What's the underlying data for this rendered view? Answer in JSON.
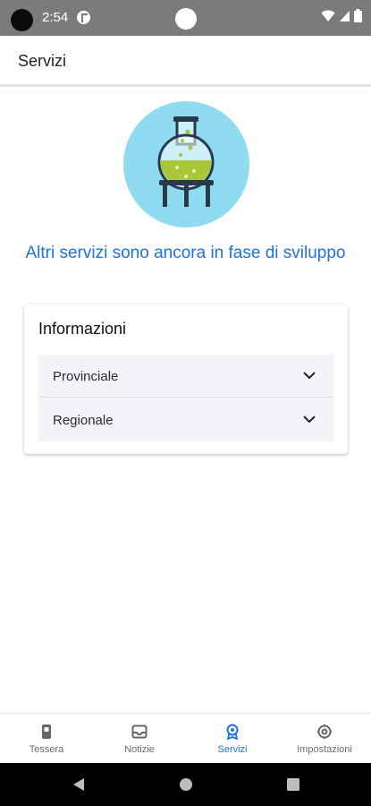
{
  "status_bar": {
    "time": "2:54",
    "icons": [
      "wifi-icon",
      "signal-icon",
      "battery-icon"
    ]
  },
  "app_bar": {
    "title": "Servizi"
  },
  "hero": {
    "icon": "flask-icon",
    "message": "Altri servizi sono ancora in fase di sviluppo"
  },
  "info_card": {
    "title": "Informazioni",
    "items": [
      {
        "label": "Provinciale",
        "icon": "chevron-down-icon"
      },
      {
        "label": "Regionale",
        "icon": "chevron-down-icon"
      }
    ]
  },
  "bottom_nav": {
    "items": [
      {
        "label": "Tessera",
        "icon": "card-icon"
      },
      {
        "label": "Notizie",
        "icon": "inbox-icon"
      },
      {
        "label": "Servizi",
        "icon": "award-icon"
      },
      {
        "label": "Impostazioni",
        "icon": "settings-icon"
      }
    ],
    "active": "Servizi",
    "active_color": "#1f73e0"
  },
  "colors": {
    "status_bar": "#7b7b7b",
    "accent": "#1f73e0",
    "hero_circle": "#8fdcf1",
    "accordion_bg": "#f3f4f8"
  }
}
